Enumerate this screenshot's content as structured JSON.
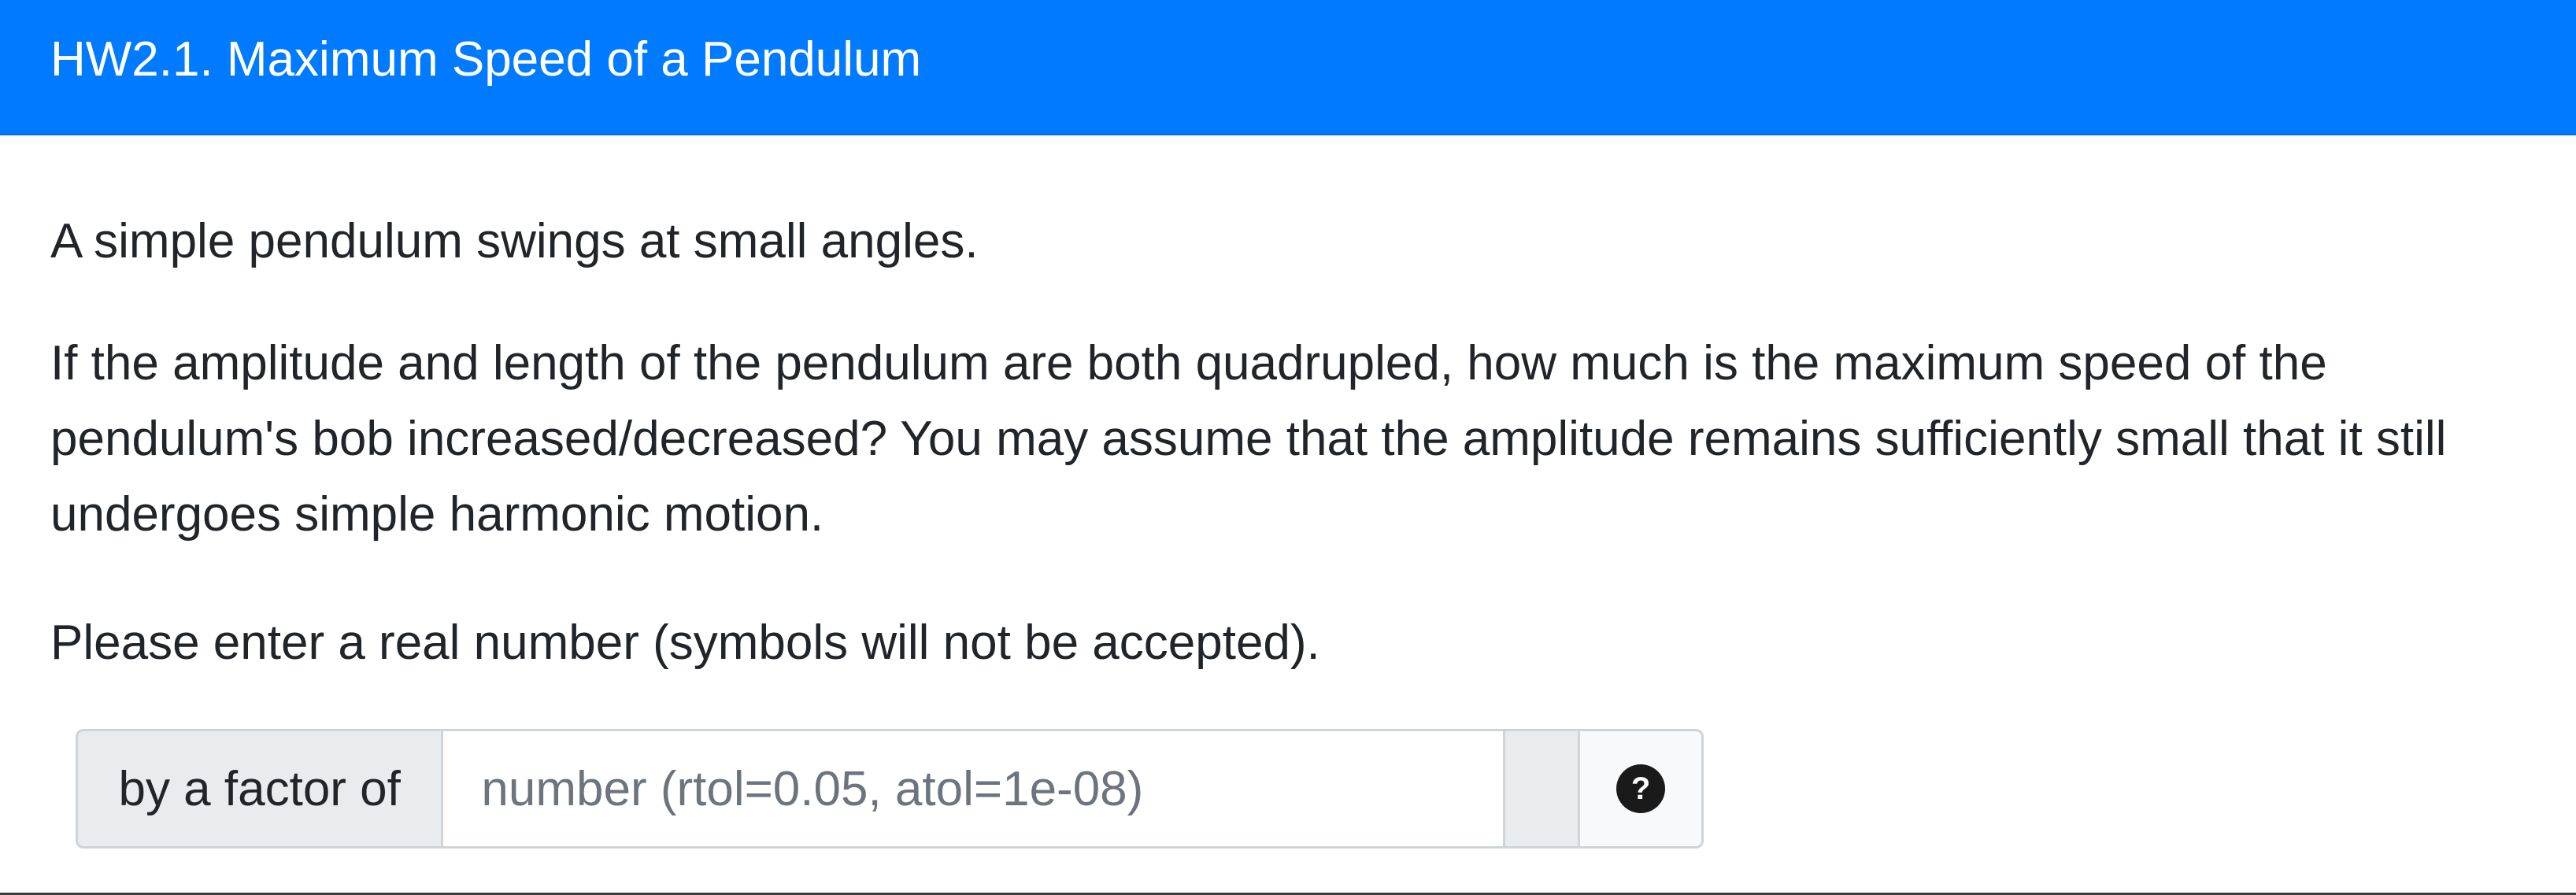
{
  "header": {
    "title": "HW2.1. Maximum Speed of a Pendulum",
    "background_color": "#007bff"
  },
  "question": {
    "intro": "A simple pendulum swings at small angles.",
    "body": "If the amplitude and length of the pendulum are both quadrupled, how much is the maximum speed of the pendulum's bob increased/decreased? You may assume that the amplitude remains sufficiently small that it still undergoes simple harmonic motion.",
    "instruction": "Please enter a real number (symbols will not be accepted)."
  },
  "answer": {
    "prefix_label": "by a factor of",
    "value": "",
    "placeholder": "number (rtol=0.05, atol=1e-08)",
    "help_icon": "question-circle-icon",
    "help_symbol": "?"
  }
}
